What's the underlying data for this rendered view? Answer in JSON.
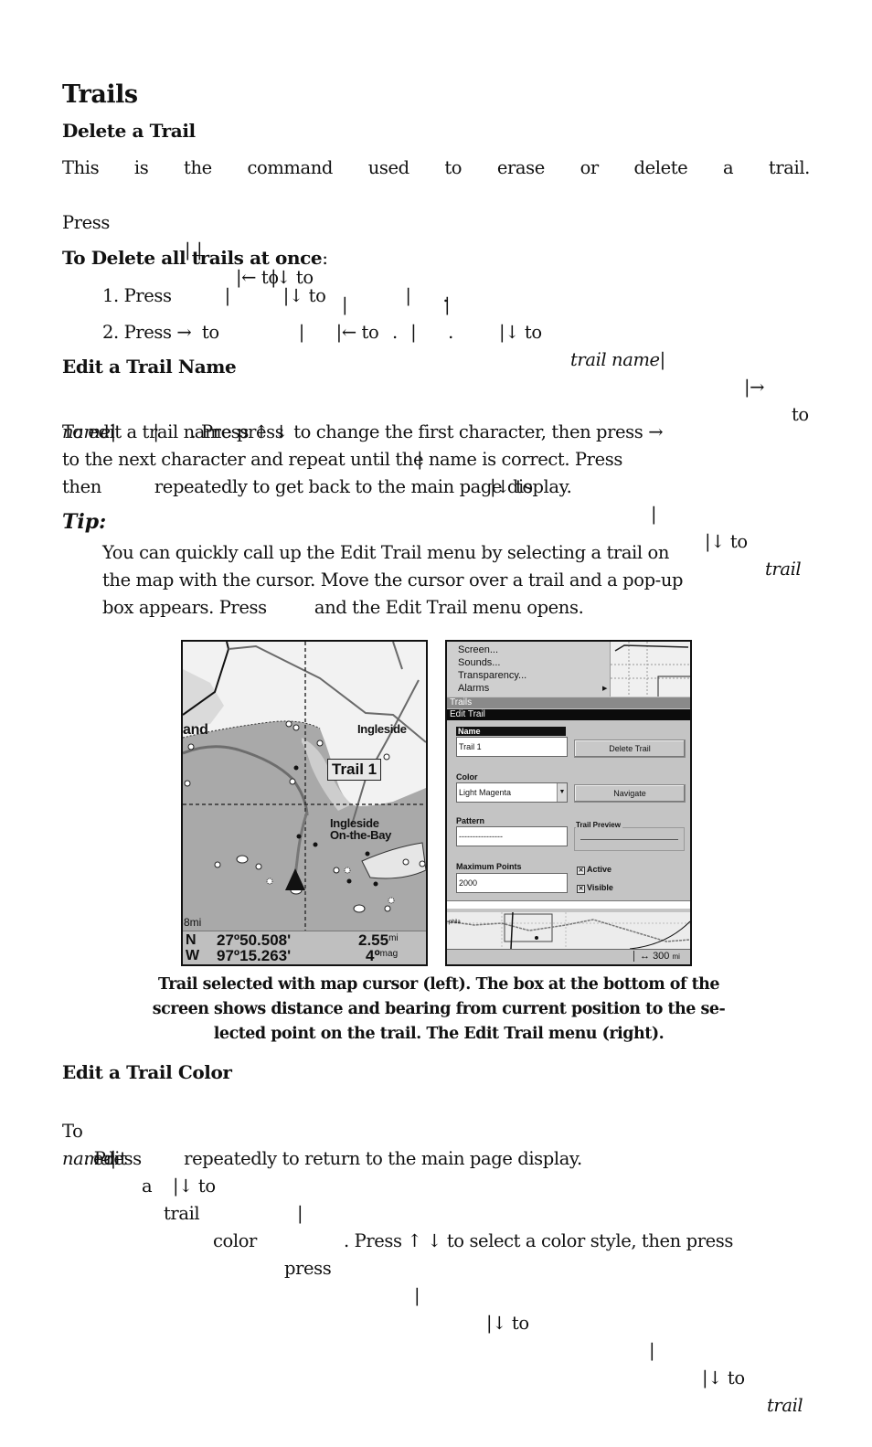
{
  "title": "Trails",
  "delete_trail": {
    "heading": "Delete a Trail",
    "lines": [
      [
        "This",
        "is",
        "the",
        "command",
        "used",
        "to",
        "erase",
        "or",
        "delete",
        "a",
        "trail."
      ],
      [
        "Press",
        "|",
        "|↓ to",
        "|",
        "|↓ to",
        "trail name|",
        "|→",
        "to"
      ],
      [
        "|",
        "|← to",
        "|",
        "."
      ]
    ]
  },
  "delete_all": {
    "heading": "To Delete all trails at once",
    "heading_suffix": ":",
    "steps": [
      "1. Press          |          |↓ to               |      .",
      "2. Press →  to               |      |← to      |      ."
    ]
  },
  "edit_name": {
    "heading": "Edit a Trail Name",
    "line1": [
      "To edit a trail name press",
      "|",
      "|↓ to",
      "|",
      "|↓ to",
      "trail"
    ],
    "line2_italic": "name",
    "line2_rest": "|       |      . Press ↑ ↓ to change the first character, then press →",
    "line3": "to the next character and repeat until the name is correct. Press",
    "line4": "then          repeatedly to get back to the main page display."
  },
  "tip": {
    "label": "Tip:",
    "lines": [
      "You can quickly call up the Edit Trail menu by selecting a trail on",
      "the map with the cursor. Move the cursor over a trail and a pop-up",
      "box appears. Press         and the Edit Trail menu opens."
    ]
  },
  "map_screen": {
    "labels": {
      "town_partial": "and",
      "ingleside": "Ingleside",
      "ingleside_bay_1": "Ingleside",
      "ingleside_bay_2": "On-the-Bay"
    },
    "popup": "Trail 1",
    "scale": "8mi",
    "lat_dir": "N",
    "lat": "27º50.508'",
    "lon_dir": "W",
    "lon": "97º15.263'",
    "distance": "2.55",
    "distance_unit": "mi",
    "bearing": "4º",
    "bearing_unit": "mag"
  },
  "menu_screen": {
    "menu_items": [
      "Screen...",
      "Sounds...",
      "Transparency...",
      "Alarms"
    ],
    "trails_bar": "Trails",
    "edit_bar": "Edit Trail",
    "name_label": "Name",
    "name_value": "Trail 1",
    "delete_button": "Delete Trail",
    "color_label": "Color",
    "color_value": "Light Magenta",
    "navigate_button": "Navigate",
    "pattern_label": "Pattern",
    "pattern_value": "----------------",
    "preview_label": "Trail Preview",
    "max_points_label": "Maximum Points",
    "max_points_value": "2000",
    "active_label": "Active",
    "active_checked": true,
    "visible_label": "Visible",
    "visible_checked": true,
    "scale_arrow": "↔",
    "scale_value": "300",
    "scale_unit": "mi"
  },
  "caption": [
    "Trail selected with map cursor (left). The box at the bottom of the",
    "screen shows distance and bearing from current position to the se-",
    "lected point on the trail. The Edit Trail menu (right)."
  ],
  "edit_color": {
    "heading": "Edit a Trail Color",
    "line1": [
      "To",
      "edit",
      "a",
      "trail",
      "color",
      "press",
      "|",
      "|↓ to",
      "|",
      "|↓ to",
      "trail"
    ],
    "line2": [
      "name|",
      "|↓ to",
      "|",
      ". Press ↑ ↓ to select a color style, then press"
    ],
    "line3": "    . Press        repeatedly to return to the main page display."
  }
}
